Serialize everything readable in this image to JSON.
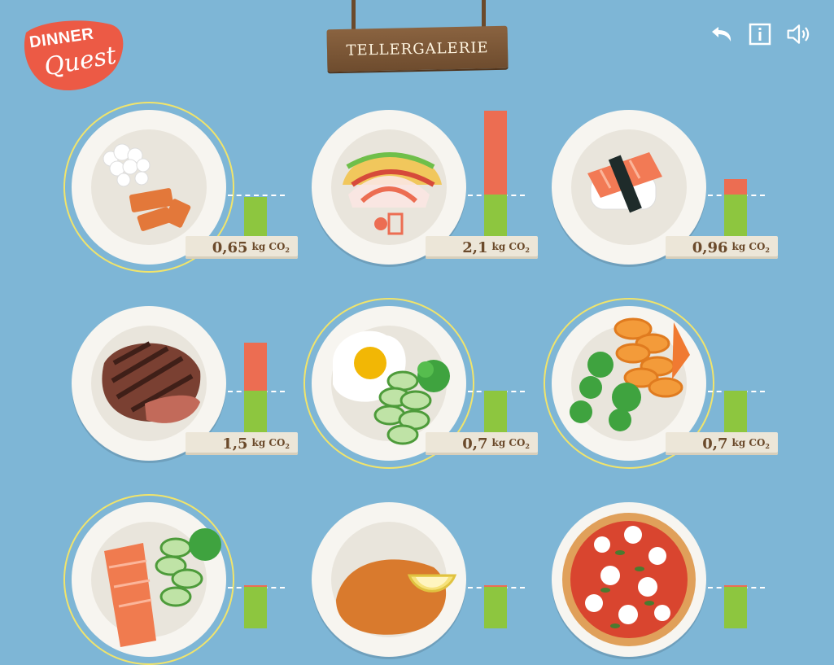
{
  "app": {
    "logo": {
      "line1": "DINNER",
      "line2": "Quest"
    },
    "title": "TELLERGALERIE",
    "controls": [
      {
        "name": "back-icon"
      },
      {
        "name": "info-icon"
      },
      {
        "name": "sound-icon"
      }
    ]
  },
  "unit": {
    "text": "kg CO",
    "sub": "2"
  },
  "plates": [
    {
      "food": "fish-fingers-and-cauliflower",
      "value": "0,65",
      "co2": 0.65,
      "highlight": true
    },
    {
      "food": "tacos",
      "value": "2,1",
      "co2": 2.1,
      "highlight": false
    },
    {
      "food": "salmon-sushi",
      "value": "0,96",
      "co2": 0.96,
      "highlight": false
    },
    {
      "food": "steak",
      "value": "1,5",
      "co2": 1.5,
      "highlight": false
    },
    {
      "food": "egg-cucumber-broccoli",
      "value": "0,7",
      "co2": 0.7,
      "highlight": true
    },
    {
      "food": "carrots-broccoli",
      "value": "0,7",
      "co2": 0.7,
      "highlight": true
    },
    {
      "food": "salmon-cucumber-broccoli",
      "value": "",
      "co2": null,
      "highlight": true
    },
    {
      "food": "schnitzel-lemon",
      "value": "",
      "co2": null,
      "highlight": false
    },
    {
      "food": "pizza",
      "value": "",
      "co2": null,
      "highlight": false
    }
  ],
  "colors": {
    "background": "#7eb6d6",
    "bar_ok": "#8dc63f",
    "bar_over": "#ec6d52",
    "logo": "#ec5a45"
  }
}
